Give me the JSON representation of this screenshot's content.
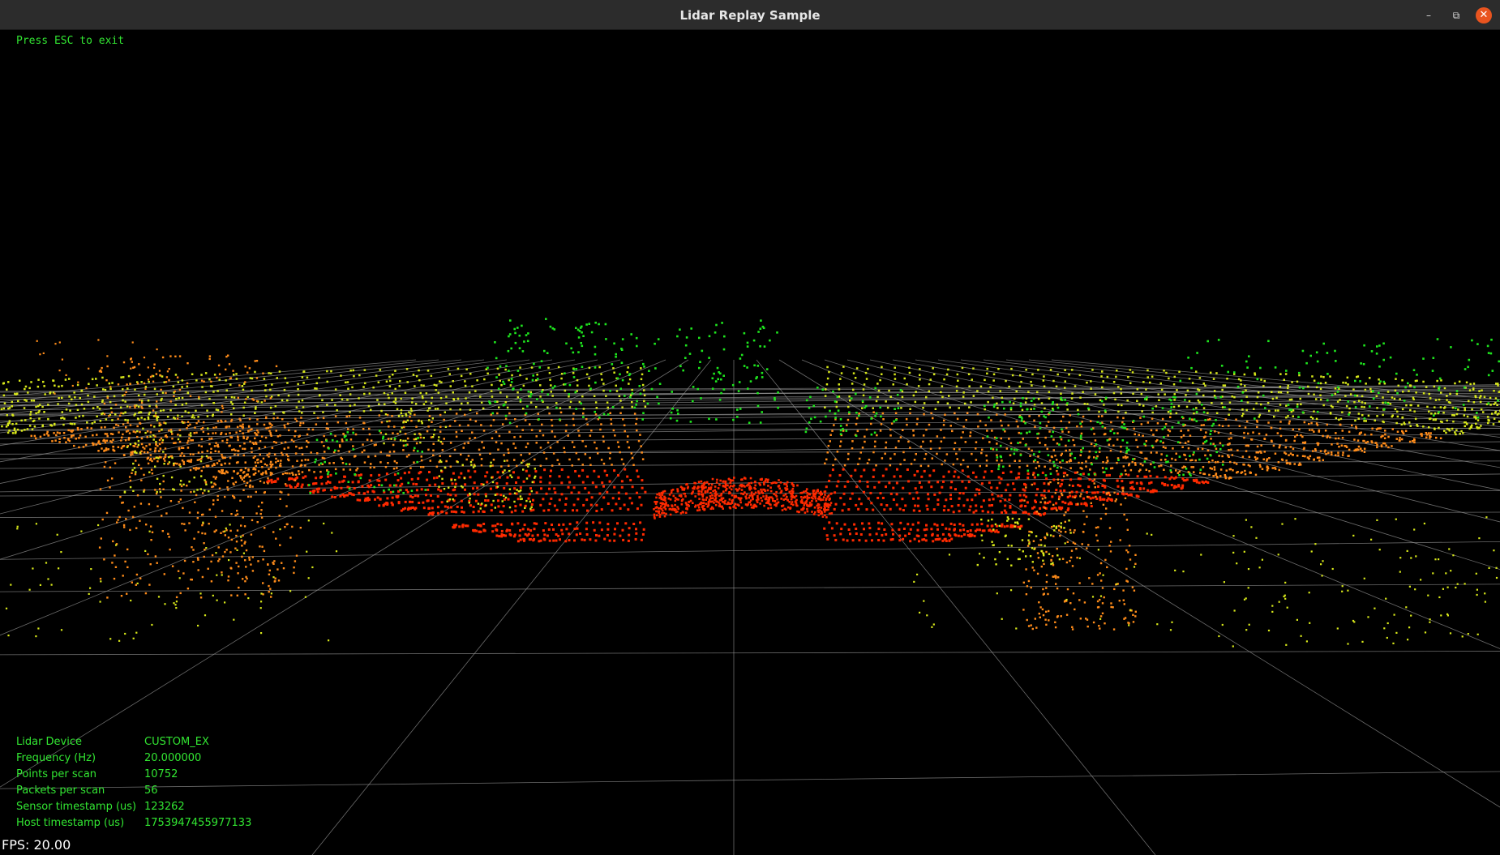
{
  "window": {
    "title": "Lidar Replay Sample",
    "controls": {
      "minimize_icon": "minimize-icon",
      "maximize_icon": "maximize-icon",
      "close_icon": "close-icon"
    }
  },
  "overlay": {
    "hint": "Press ESC to exit",
    "fps": "FPS: 20.00"
  },
  "info": [
    {
      "label": "Lidar Device",
      "value": "CUSTOM_EX"
    },
    {
      "label": "Frequency (Hz)",
      "value": "20.000000"
    },
    {
      "label": "Points per scan",
      "value": "10752"
    },
    {
      "label": "Packets per scan",
      "value": "56"
    },
    {
      "label": "Sensor timestamp (us)",
      "value": "123262"
    },
    {
      "label": "Host timestamp   (us)",
      "value": "1753947455977133"
    }
  ],
  "colors": {
    "near": "#ff2a00",
    "mid": "#ff8c1a",
    "far": "#d8e81a",
    "farthest": "#1ee61e",
    "grid": "#9a9a9a",
    "text": "#32e632",
    "background": "#000000"
  }
}
